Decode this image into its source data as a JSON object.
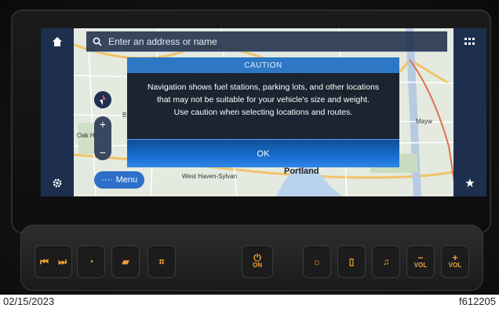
{
  "search": {
    "placeholder": "Enter an address or name"
  },
  "dialog": {
    "title": "CAUTION",
    "message_lines": [
      "Navigation shows fuel stations, parking lots, and other locations",
      "that may not be suitable for your vehicle's size and weight.",
      "Use caution when selecting locations and routes."
    ],
    "ok_label": "OK"
  },
  "menu_label": "Menu",
  "map_labels": {
    "portland": "Portland",
    "west_haven": "West Haven-Sylvan",
    "oak_hills": "Oak H",
    "mayw": "Mayw",
    "b": "B"
  },
  "hardware": {
    "power_label": "ON",
    "vol_label": "VOL"
  },
  "caption": {
    "date": "02/15/2023",
    "figure_id": "f612205"
  },
  "colors": {
    "accent_blue": "#2d77c4",
    "hardware_orange": "#f2a23a",
    "rail": "#1e2f4e"
  },
  "icons": [
    "home-icon",
    "search-icon",
    "apps-grid-icon",
    "compass-icon",
    "settings-icon",
    "star-icon",
    "prev-track-icon",
    "next-track-icon",
    "gauge-icon",
    "truck-icon",
    "transmission-icon",
    "power-icon",
    "light-icon",
    "phone-icon",
    "music-icon",
    "volume-down-icon",
    "volume-up-icon"
  ]
}
